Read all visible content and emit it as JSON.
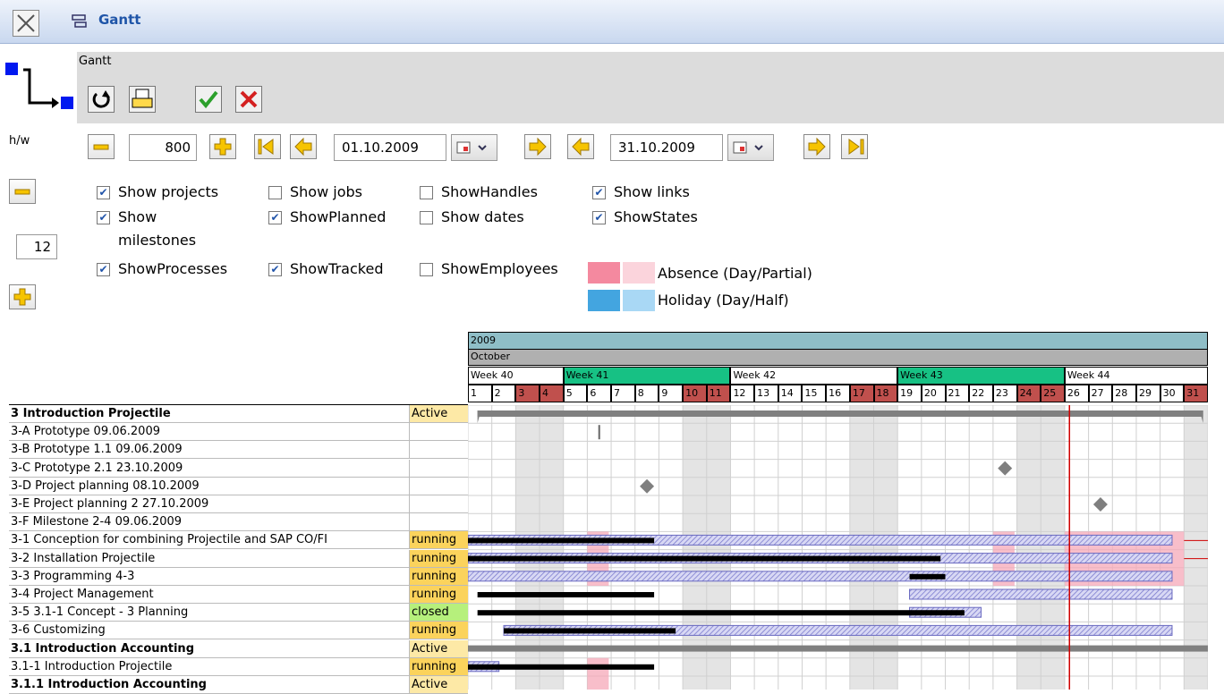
{
  "window": {
    "title": "Gantt"
  },
  "toolbar": {
    "caption": "Gantt"
  },
  "controls": {
    "hw_label": "h/w",
    "width_value": "800",
    "height_value": "12",
    "start_date": "01.10.2009",
    "end_date": "31.10.2009"
  },
  "options": [
    {
      "label": "Show projects",
      "checked": true
    },
    {
      "label": "Show jobs",
      "checked": false
    },
    {
      "label": "ShowHandles",
      "checked": false
    },
    {
      "label": "Show links",
      "checked": true
    },
    {
      "label": "Show",
      "label2": "milestones",
      "checked": true
    },
    {
      "label": "ShowPlanned",
      "checked": true
    },
    {
      "label": "Show dates",
      "checked": false
    },
    {
      "label": "ShowStates",
      "checked": true
    },
    {
      "label": "ShowProcesses",
      "checked": true
    },
    {
      "label": "ShowTracked",
      "checked": true
    },
    {
      "label": "ShowEmployees",
      "checked": false
    }
  ],
  "legend": {
    "absence_label": "Absence (Day/Partial)",
    "holiday_label": "Holiday (Day/Half)",
    "absence_colors": [
      "#f4899f",
      "#fbd4dc"
    ],
    "holiday_colors": [
      "#43a5e0",
      "#a9d8f5"
    ]
  },
  "timeline": {
    "year": "2009",
    "month": "October",
    "weeks": [
      "Week 40",
      "Week 41",
      "Week 42",
      "Week 43",
      "Week 44"
    ],
    "days": [
      "1",
      "2",
      "3",
      "4",
      "5",
      "6",
      "7",
      "8",
      "9",
      "10",
      "11",
      "12",
      "13",
      "14",
      "15",
      "16",
      "17",
      "18",
      "19",
      "20",
      "21",
      "22",
      "23",
      "24",
      "25",
      "26",
      "27",
      "28",
      "29",
      "30",
      "31"
    ]
  },
  "rows": [
    {
      "name": "3 Introduction Projectile",
      "status": "Active",
      "bold": true
    },
    {
      "name": "3-A Prototype 09.06.2009",
      "status": ""
    },
    {
      "name": "3-B Prototype 1.1 09.06.2009",
      "status": ""
    },
    {
      "name": "3-C Prototype 2.1 23.10.2009",
      "status": ""
    },
    {
      "name": "3-D Project planning 08.10.2009",
      "status": ""
    },
    {
      "name": "3-E Project planning 2 27.10.2009",
      "status": ""
    },
    {
      "name": "3-F Milestone 2-4 09.06.2009",
      "status": ""
    },
    {
      "name": "3-1 Conception for combining Projectile and SAP CO/FI",
      "status": "running"
    },
    {
      "name": "3-2 Installation  Projectile",
      "status": "running"
    },
    {
      "name": "3-3 Programming 4-3",
      "status": "running"
    },
    {
      "name": "3-4 Project Management",
      "status": "running"
    },
    {
      "name": "3-5 3.1-1 Concept - 3 Planning",
      "status": "closed"
    },
    {
      "name": "3-6 Customizing",
      "status": "running"
    },
    {
      "name": "3.1 Introduction Accounting",
      "status": "Active",
      "bold": true
    },
    {
      "name": "3.1-1 Introduction Projectile",
      "status": "running"
    },
    {
      "name": "3.1.1 Introduction Accounting",
      "status": "Active",
      "bold": true
    }
  ],
  "status_colors": {
    "Active": "#fde9a6",
    "running": "#fbd35c",
    "closed": "#b6f07c"
  },
  "colors": {
    "week_highlight": "#17c184",
    "weekend_day": "#c0504d",
    "year_bar": "#8fbec7",
    "month_bar": "#b0b0b0",
    "today_line": "#d00000"
  },
  "today_day": 26.2,
  "milestones": [
    {
      "row": 3,
      "day": 23.5
    },
    {
      "row": 4,
      "day": 8.5
    },
    {
      "row": 5,
      "day": 27.5
    }
  ],
  "tick_marks": [
    {
      "row": 1,
      "day": 6.5
    }
  ],
  "summary_bars": [
    {
      "row": 0,
      "from": 1.4,
      "to": 31.8
    },
    {
      "row": 13,
      "from": 1,
      "to": 32
    }
  ],
  "planned_bars": [
    {
      "row": 7,
      "from": 1,
      "to": 30.5
    },
    {
      "row": 8,
      "from": 1,
      "to": 30.5
    },
    {
      "row": 9,
      "from": 1,
      "to": 30.5
    },
    {
      "row": 10,
      "from": 19.5,
      "to": 30.5
    },
    {
      "row": 11,
      "from": 19.5,
      "to": 22.5
    },
    {
      "row": 12,
      "from": 2.5,
      "to": 30.5
    },
    {
      "row": 14,
      "from": 1,
      "to": 2.3
    }
  ],
  "tracked_bars": [
    {
      "row": 7,
      "from": 1,
      "to": 8.8
    },
    {
      "row": 8,
      "from": 1,
      "to": 20.8
    },
    {
      "row": 9,
      "from": 19.5,
      "to": 21
    },
    {
      "row": 10,
      "from": 1.4,
      "to": 8.8
    },
    {
      "row": 11,
      "from": 1.4,
      "to": 21.8
    },
    {
      "row": 12,
      "from": 2.5,
      "to": 9.7
    },
    {
      "row": 14,
      "from": 1,
      "to": 8.8
    }
  ],
  "absence_blocks": [
    {
      "rows": [
        7,
        9
      ],
      "from": 6,
      "to": 6.9
    },
    {
      "rows": [
        7,
        9
      ],
      "from": 23,
      "to": 23.9
    },
    {
      "rows": [
        7,
        9
      ],
      "from": 26,
      "to": 31
    },
    {
      "rows": [
        14,
        15
      ],
      "from": 6,
      "to": 6.9
    }
  ]
}
